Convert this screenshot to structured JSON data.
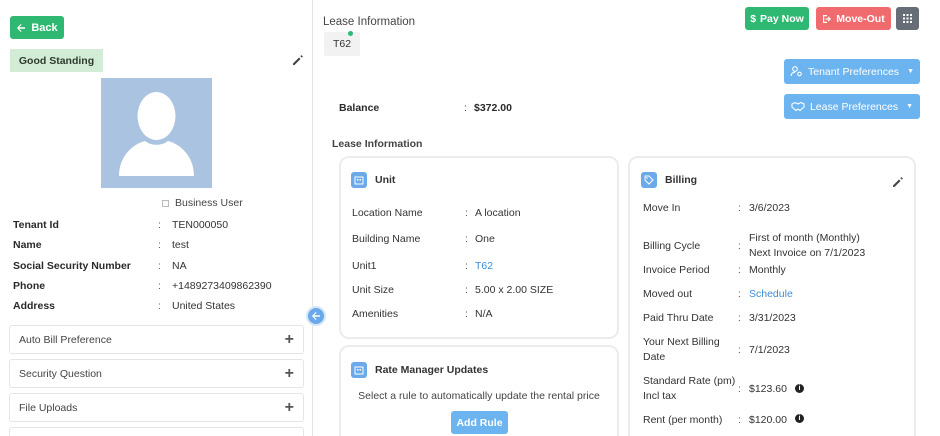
{
  "left": {
    "back_label": "Back",
    "standing_badge": "Good Standing",
    "business_user_label": "Business User",
    "fields": [
      {
        "label": "Tenant Id",
        "value": "TEN000050"
      },
      {
        "label": "Name",
        "value": "test"
      },
      {
        "label": "Social Security Number",
        "value": "NA"
      },
      {
        "label": "Phone",
        "value": "+1489273409862390"
      },
      {
        "label": "Address",
        "value": "United States"
      }
    ],
    "accordions": [
      "Auto Bill Preference",
      "Security Question",
      "File Uploads"
    ]
  },
  "header": {
    "title": "Lease Information",
    "tab_label": "T62",
    "pay_now_label": "Pay Now",
    "move_out_label": "Move-Out",
    "tenant_pref_label": "Tenant Preferences",
    "lease_pref_label": "Lease Preferences"
  },
  "balance": {
    "label": "Balance",
    "value": "$372.00"
  },
  "lease_info_subtitle": "Lease Information",
  "unit_card": {
    "title": "Unit",
    "rows": [
      {
        "label": "Location Name",
        "value": "A location"
      },
      {
        "label": "Building Name",
        "value": "One"
      },
      {
        "label": "Unit1",
        "value": "T62"
      },
      {
        "label": "Unit Size",
        "value": "5.00 x 2.00 SIZE"
      },
      {
        "label": "Amenities",
        "value": "N/A"
      }
    ]
  },
  "rate_card": {
    "title": "Rate Manager Updates",
    "description": "Select a rule to automatically update the rental price",
    "button_label": "Add Rule"
  },
  "billing_card": {
    "title": "Billing",
    "rows": [
      {
        "label": "Move In",
        "value": "3/6/2023"
      },
      {
        "label": "Billing Cycle",
        "value": "First of month (Monthly)",
        "value2": "Next Invoice on 7/1/2023"
      },
      {
        "label": "Invoice Period",
        "value": "Monthly"
      },
      {
        "label": "Moved out",
        "value": "Schedule"
      },
      {
        "label": "Paid Thru Date",
        "value": "3/31/2023"
      },
      {
        "label": "Your Next Billing",
        "label2": "Date",
        "value": "7/1/2023"
      },
      {
        "label": "Standard Rate (pm)",
        "label2": "Incl tax",
        "value": "$123.60"
      },
      {
        "label": "Rent (per month)",
        "value": "$120.00"
      }
    ]
  },
  "colors": {
    "green": "#2eb872",
    "red": "#ef6b6e",
    "blue": "#6cb4ef",
    "link": "#3c8ed9",
    "badge_bg": "#d3ecd6",
    "avatar_bg": "#a9c3e1"
  }
}
